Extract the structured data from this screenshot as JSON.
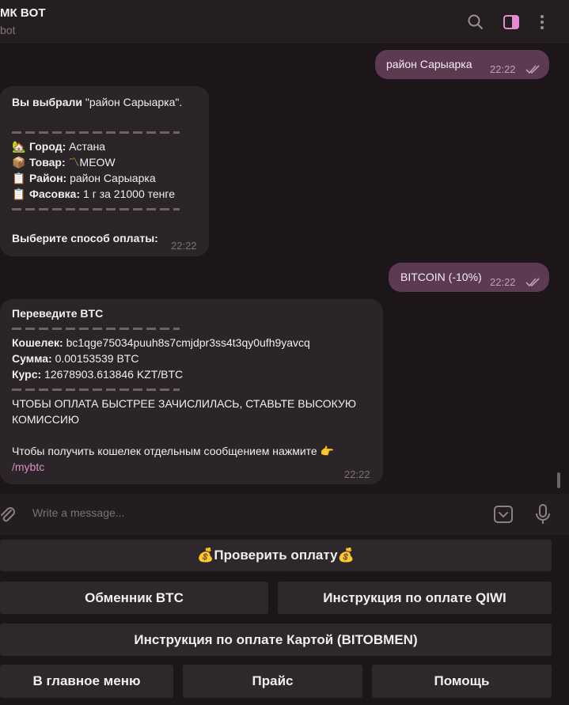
{
  "header": {
    "title": "МК BOT",
    "subtitle": "bot"
  },
  "messages": [
    {
      "text": "район Сарыарка",
      "time": "22:22"
    },
    {
      "selected_label": "Вы выбрали",
      "selected_value": "\"район Сарыарка\".",
      "city_label": "Город:",
      "city_value": "Астана",
      "product_label": "Товар:",
      "product_value": "MEOW",
      "district_label": "Район:",
      "district_value": "район Сарыарка",
      "package_label": "Фасовка:",
      "package_value": "1 г за 21000 тенге",
      "prompt": "Выберите способ оплаты:",
      "time": "22:22"
    },
    {
      "text": "BITCOIN (-10%)",
      "time": "22:22"
    },
    {
      "heading": "Переведите BTC",
      "wallet_label": "Кошелек:",
      "wallet_value": "bc1qge75034puuh8s7cmjdpr3ss4t3qy0ufh9yavcq",
      "amount_label": "Сумма:",
      "amount_value": "0.00153539 BTC",
      "rate_label": "Курс:",
      "rate_value": "12678903.613846 KZT/BTC",
      "warning_line1": "ЧТОБЫ ОПЛАТА БЫСТРЕЕ ЗАЧИСЛИЛАСЬ, СТАВЬТЕ ВЫСОКУЮ",
      "warning_line2": "КОМИССИЮ",
      "hint": "Чтобы получить кошелек отдельным сообщением нажмите",
      "hint_emoji": "👉",
      "command": "/mybtc",
      "time": "22:22"
    }
  ],
  "composer": {
    "placeholder": "Write a message..."
  },
  "keyboard": {
    "check_payment": "💰Проверить оплату💰",
    "exchanger": "Обменник BTC",
    "qiwi_instructions": "Инструкция по оплате QIWI",
    "card_instructions": "Инструкция по оплате Картой (BITOBMEN)",
    "main_menu": "В главное меню",
    "price": "Прайс",
    "help": "Помощь"
  },
  "colors": {
    "accent": "#e88ad2",
    "outgoing_bubble": "#5b3a52",
    "incoming_bubble": "#2b2428",
    "button": "#2e272b"
  }
}
